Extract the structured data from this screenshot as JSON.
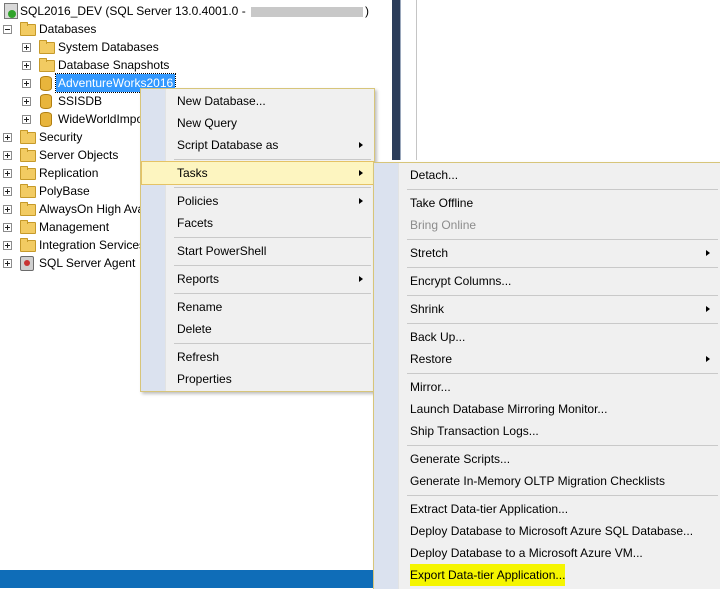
{
  "tree": {
    "server": {
      "name_prefix": "SQL2016_DEV (SQL Server 13.0.4001.0 - ",
      "name_suffix": ")"
    },
    "databases": "Databases",
    "db_children": [
      "System Databases",
      "Database Snapshots",
      "AdventureWorks2016",
      "SSISDB",
      "WideWorldImpo"
    ],
    "server_children": [
      "Security",
      "Server Objects",
      "Replication",
      "PolyBase",
      "AlwaysOn High Ava",
      "Management",
      "Integration Services",
      "SQL Server Agent"
    ]
  },
  "context_menu": {
    "items": [
      "New Database...",
      "New Query",
      "Script Database as",
      "Tasks",
      "Policies",
      "Facets",
      "Start PowerShell",
      "Reports",
      "Rename",
      "Delete",
      "Refresh",
      "Properties"
    ]
  },
  "tasks_menu": {
    "items": [
      "Detach...",
      "Take Offline",
      "Bring Online",
      "Stretch",
      "Encrypt Columns...",
      "Shrink",
      "Back Up...",
      "Restore",
      "Mirror...",
      "Launch Database Mirroring Monitor...",
      "Ship Transaction Logs...",
      "Generate Scripts...",
      "Generate In-Memory OLTP Migration Checklists",
      "Extract Data-tier Application...",
      "Deploy Database to Microsoft Azure SQL Database...",
      "Deploy Database to a Microsoft Azure VM...",
      "Export Data-tier Application..."
    ]
  },
  "colors": {
    "highlight": "#f5f500",
    "selection": "#3399ff",
    "statusbar": "#0f6db8"
  }
}
